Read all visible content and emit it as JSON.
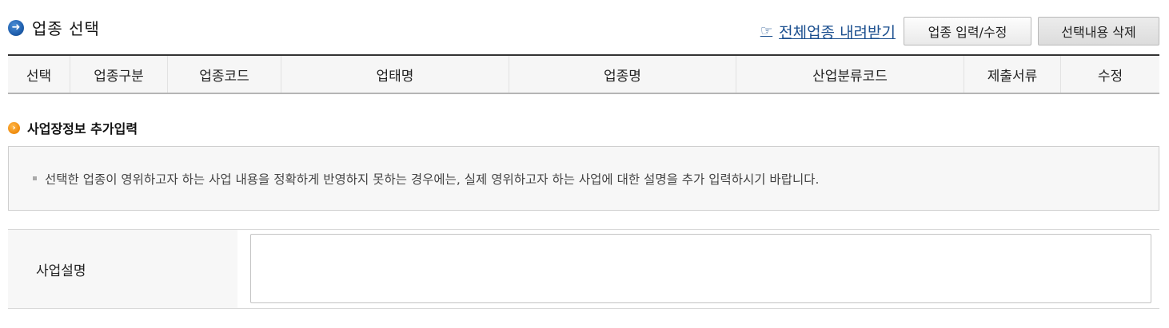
{
  "section": {
    "title": "업종 선택",
    "download_link": "전체업종 내려받기",
    "hand_glyph": "☞",
    "icons": {
      "title_icon": "arrow-circle-icon",
      "link_icon": "pointing-hand-icon"
    },
    "buttons": {
      "edit": "업종 입력/수정",
      "delete": "선택내용 삭제"
    }
  },
  "table": {
    "columns": [
      "선택",
      "업종구분",
      "업종코드",
      "업태명",
      "업종명",
      "산업분류코드",
      "제출서류",
      "수정"
    ]
  },
  "extra": {
    "title": "사업장정보 추가입력",
    "notice": "선택한 업종이 영위하고자 하는 사업 내용을 정확하게 반영하지 못하는 경우에는, 실제 영위하고자 하는 사업에 대한 설명을 추가 입력하시기 바랍니다.",
    "field_label": "사업설명",
    "field_value": ""
  },
  "colors": {
    "link": "#1b4f8f",
    "title_icon": "#1f5fae",
    "sub_icon": "#ef8a0c",
    "header_bg": "#f6f6f6"
  }
}
